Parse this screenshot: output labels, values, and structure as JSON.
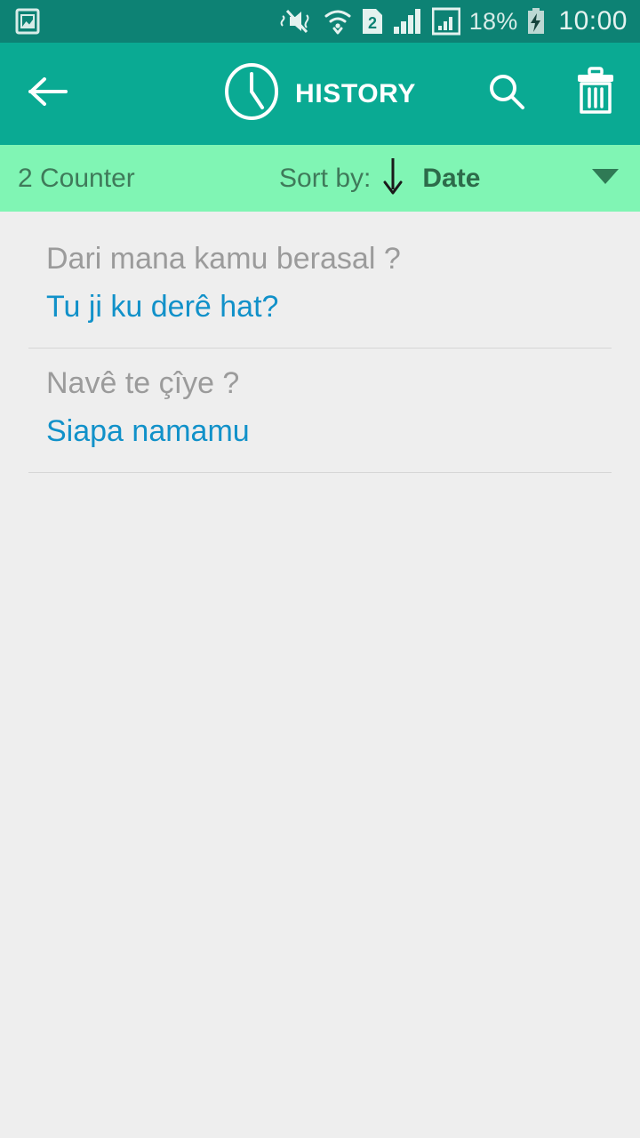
{
  "status_bar": {
    "notification_icon": "image-notification-icon",
    "icons": [
      "mute-vibrate-icon",
      "wifi-icon",
      "sim-2-icon",
      "signal-bars-icon",
      "signal-bars-boxed-icon"
    ],
    "battery_percent": "18%",
    "battery_icon": "battery-charging-icon",
    "time": "10:00",
    "background_color": "#0d8274"
  },
  "app_bar": {
    "back_icon": "back-arrow-icon",
    "clock_icon": "clock-icon",
    "title": "HISTORY",
    "search_icon": "search-icon",
    "delete_icon": "trash-icon",
    "background_color": "#0aaa93"
  },
  "sort_bar": {
    "counter": "2 Counter",
    "sort_by_label": "Sort by:",
    "sort_direction_icon": "arrow-down-icon",
    "sort_value": "Date",
    "dropdown_icon": "caret-down-icon",
    "background_color": "#80f5b4"
  },
  "history": {
    "items": [
      {
        "source": "Dari mana kamu berasal ?",
        "target": "Tu ji ku derê hat?"
      },
      {
        "source": "Navê te çîye ?",
        "target": "Siapa namamu"
      }
    ]
  },
  "colors": {
    "accent_teal": "#0aaa93",
    "status_teal": "#0d8274",
    "mint": "#80f5b4",
    "translation_blue": "#1191c9",
    "source_grey": "#9b9b9b",
    "page_background": "#eeeeee"
  }
}
